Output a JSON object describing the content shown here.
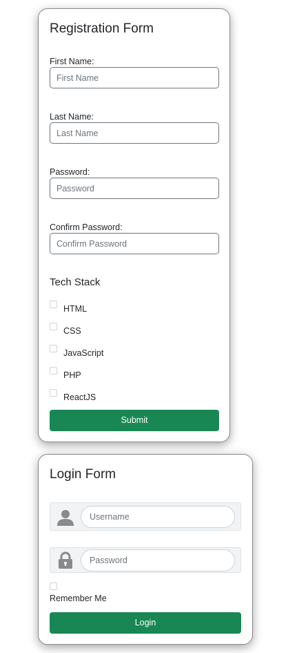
{
  "registration": {
    "title": "Registration Form",
    "fields": [
      {
        "label": "First Name:",
        "placeholder": "First Name"
      },
      {
        "label": "Last Name:",
        "placeholder": "Last Name"
      },
      {
        "label": "Password:",
        "placeholder": "Password"
      },
      {
        "label": "Confirm Password:",
        "placeholder": "Confirm Password"
      }
    ],
    "tech_stack_title": "Tech Stack",
    "tech_options": [
      {
        "label": "HTML",
        "checked": false
      },
      {
        "label": "CSS",
        "checked": false
      },
      {
        "label": "JavaScript",
        "checked": false
      },
      {
        "label": "PHP",
        "checked": false
      },
      {
        "label": "ReactJS",
        "checked": false
      }
    ],
    "submit_label": "Submit"
  },
  "login": {
    "title": "Login Form",
    "username_icon": "user-icon",
    "username_placeholder": "Username",
    "password_icon": "lock-icon",
    "password_placeholder": "Password",
    "remember_label": "Remember Me",
    "remember_checked": false,
    "login_label": "Login"
  },
  "colors": {
    "primary_button": "#198754",
    "input_border": "#6c757d",
    "icon_gray": "#8a8a8a"
  }
}
